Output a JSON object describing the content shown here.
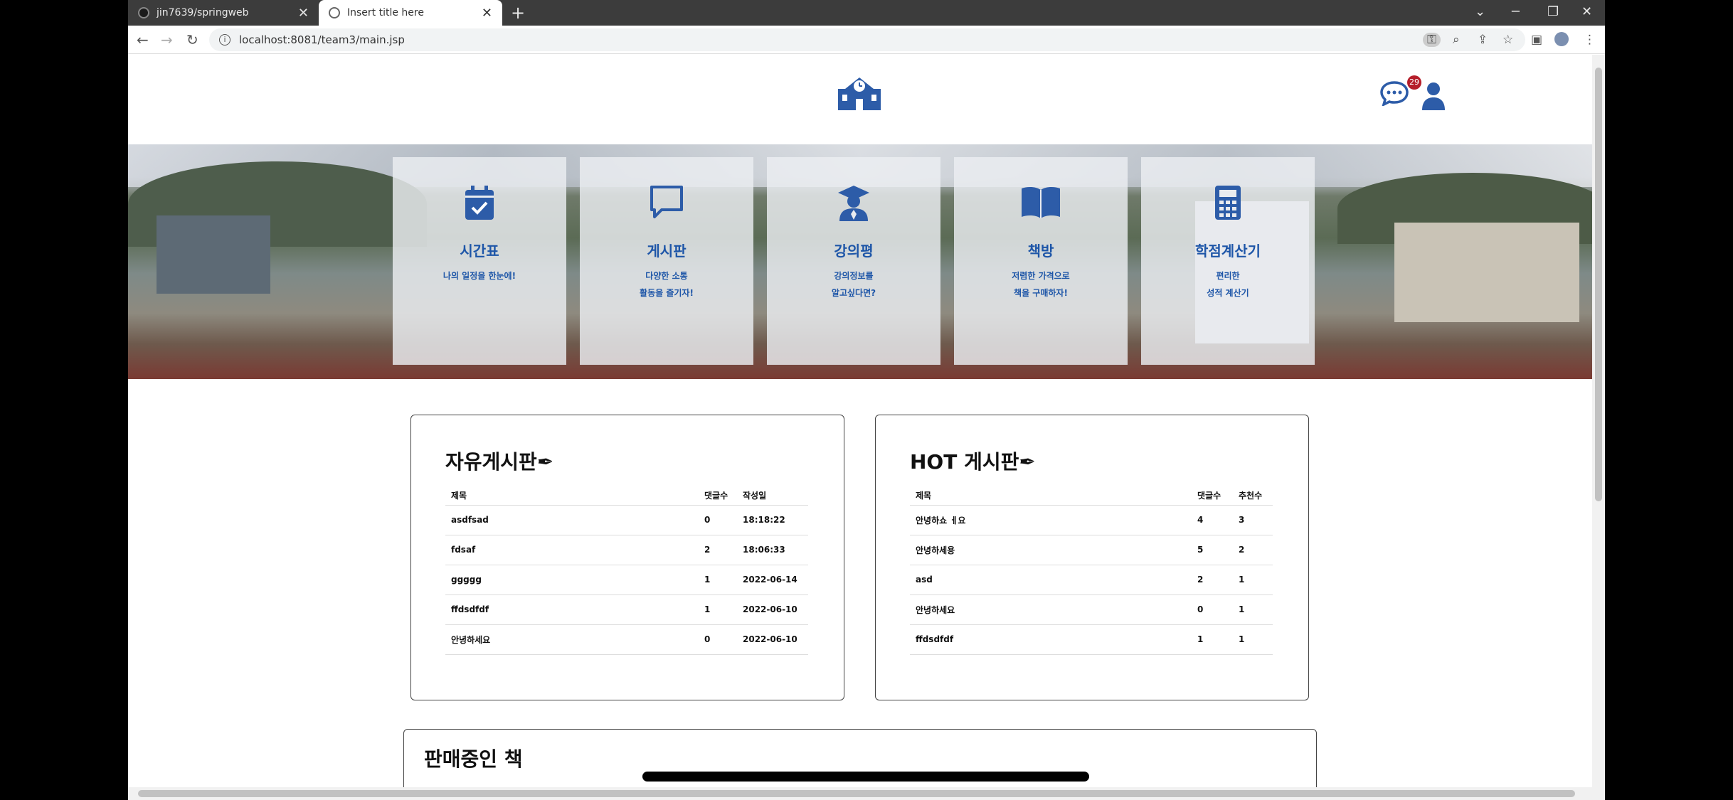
{
  "browser": {
    "tabs": [
      {
        "title": "jin7639/springweb",
        "active": false
      },
      {
        "title": "Insert title here",
        "active": true
      }
    ],
    "new_tab": "+",
    "url": "localhost:8081/team3/main.jsp"
  },
  "header": {
    "notification_count": "29"
  },
  "menu_cards": [
    {
      "title": "시간표",
      "desc1": "나의 일정을 한눈에!",
      "desc2": "",
      "icon": "calendar-check-icon"
    },
    {
      "title": "게시판",
      "desc1": "다양한 소통",
      "desc2": "활동을 즐기자!",
      "icon": "comment-icon"
    },
    {
      "title": "강의평",
      "desc1": "강의정보를",
      "desc2": "알고싶다면?",
      "icon": "graduate-icon"
    },
    {
      "title": "책방",
      "desc1": "저렴한 가격으로",
      "desc2": "책을 구매하자!",
      "icon": "book-icon"
    },
    {
      "title": "학점계산기",
      "desc1": "편리한",
      "desc2": "성적 계산기",
      "icon": "calculator-icon"
    }
  ],
  "free_board": {
    "title": "자유게시판",
    "columns": [
      "제목",
      "댓글수",
      "작성일"
    ],
    "rows": [
      [
        "asdfsad",
        "0",
        "18:18:22"
      ],
      [
        "fdsaf",
        "2",
        "18:06:33"
      ],
      [
        "ggggg",
        "1",
        "2022-06-14"
      ],
      [
        "ffdsdfdf",
        "1",
        "2022-06-10"
      ],
      [
        "안녕하세요",
        "0",
        "2022-06-10"
      ]
    ]
  },
  "hot_board": {
    "title": "HOT 게시판",
    "columns": [
      "제목",
      "댓글수",
      "추천수"
    ],
    "rows": [
      [
        "안녕하쇼 ㅔ요",
        "4",
        "3"
      ],
      [
        "안녕하세용",
        "5",
        "2"
      ],
      [
        "asd",
        "2",
        "1"
      ],
      [
        "안녕하세요",
        "0",
        "1"
      ],
      [
        "ffdsdfdf",
        "1",
        "1"
      ]
    ]
  },
  "books_section": {
    "title": "판매중인 책"
  },
  "colors": {
    "accent": "#1e56a8",
    "badge": "#b51d2a"
  }
}
